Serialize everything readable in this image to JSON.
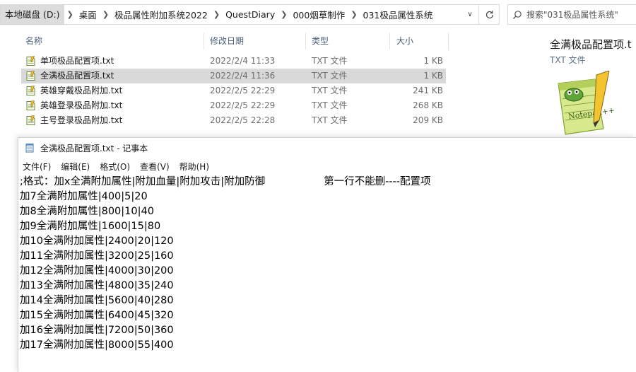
{
  "explorer": {
    "breadcrumb": [
      "本地磁盘 (D:)",
      "桌面",
      "极品属性附加系统2022",
      "QuestDiary",
      "000烟草制作",
      "031极品属性系统"
    ],
    "search_placeholder": "搜索\"031极品属性系统\"",
    "columns": {
      "name": "名称",
      "date": "修改日期",
      "type": "类型",
      "size": "大小"
    },
    "files": [
      {
        "name": "单项极品配置项.txt",
        "date": "2022/2/4 11:33",
        "type": "TXT 文件",
        "size": "1 KB",
        "selected": false
      },
      {
        "name": "全满极品配置项.txt",
        "date": "2022/2/4 11:36",
        "type": "TXT 文件",
        "size": "1 KB",
        "selected": true
      },
      {
        "name": "英雄穿戴极品附加.txt",
        "date": "2022/2/5 22:29",
        "type": "TXT 文件",
        "size": "241 KB",
        "selected": false
      },
      {
        "name": "英雄登录极品附加.txt",
        "date": "2022/2/5 22:29",
        "type": "TXT 文件",
        "size": "268 KB",
        "selected": false
      },
      {
        "name": "主号登录极品附加.txt",
        "date": "2022/2/5 22:28",
        "type": "TXT 文件",
        "size": "209 KB",
        "selected": false
      }
    ],
    "preview": {
      "title": "全满极品配置项.t",
      "type": "TXT 文件",
      "image_text": "Notepad++"
    }
  },
  "notepad": {
    "title": "全满极品配置项.txt - 记事本",
    "menu": [
      "文件(F)",
      "编辑(E)",
      "格式(O)",
      "查看(V)",
      "帮助(H)"
    ],
    "lines": [
      ";格式：加x全满附加属性|附加血量|附加攻击|附加防御                  第一行不能删----配置项",
      "加7全满附加属性|400|5|20",
      "加8全满附加属性|800|10|40",
      "加9全满附加属性|1600|15|80",
      "加10全满附加属性|2400|20|120",
      "加11全满附加属性|3200|25|160",
      "加12全满附加属性|4000|30|200",
      "加13全满附加属性|4800|35|240",
      "加14全满附加属性|5600|40|280",
      "加15全满附加属性|6400|45|320",
      "加16全满附加属性|7200|50|360",
      "加17全满附加属性|8000|55|400"
    ]
  }
}
